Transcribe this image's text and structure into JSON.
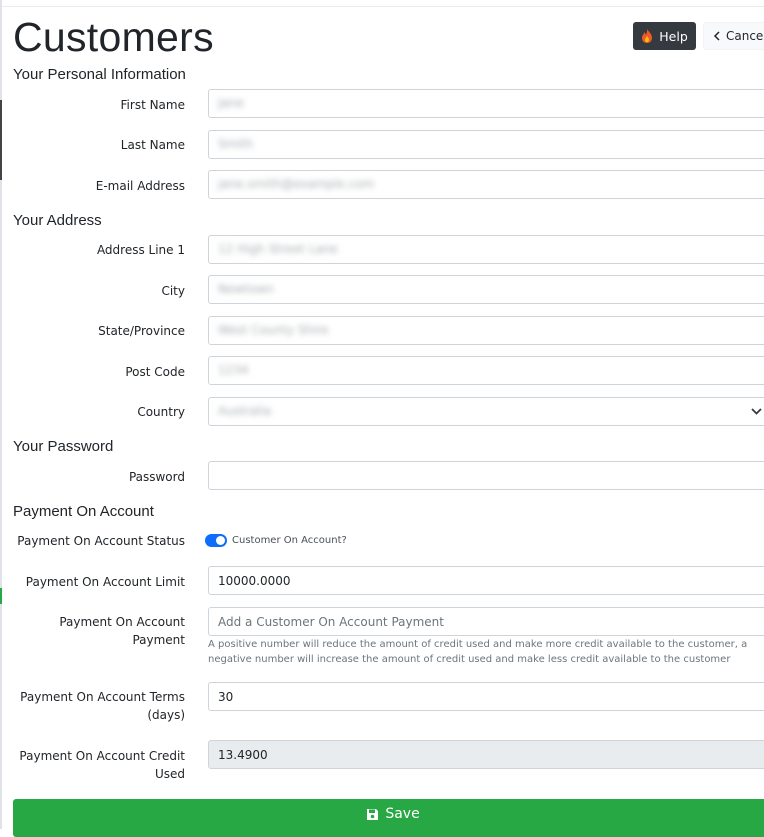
{
  "page": {
    "title": "Customers"
  },
  "header": {
    "help_label": "Help",
    "cancel_label": "Cancel"
  },
  "sections": {
    "personal": "Your Personal Information",
    "address": "Your Address",
    "password": "Your Password",
    "payment": "Payment On Account"
  },
  "personal": {
    "first_name_label": "First Name",
    "first_name_value": "Jane",
    "last_name_label": "Last Name",
    "last_name_value": "Smith",
    "email_label": "E-mail Address",
    "email_value": "jane.smith@example.com"
  },
  "address": {
    "line1_label": "Address Line 1",
    "line1_value": "12 High Street Lane",
    "city_label": "City",
    "city_value": "Newtown",
    "state_label": "State/Province",
    "state_value": "West County Shire",
    "postcode_label": "Post Code",
    "postcode_value": "1234",
    "country_label": "Country",
    "country_value": "Australia"
  },
  "password": {
    "label": "Password",
    "value": ""
  },
  "payment": {
    "status_label": "Payment On Account Status",
    "status_toggle_label": "Customer On Account?",
    "status_on": true,
    "limit_label": "Payment On Account Limit",
    "limit_value": "10000.0000",
    "payment_label": "Payment On Account Payment",
    "payment_placeholder": "Add a Customer On Account Payment",
    "payment_help": "A positive number will reduce the amount of credit used and make more credit available to the customer, a negative number will increase the amount of credit used and make less credit available to the customer",
    "terms_label": "Payment On Account Terms (days)",
    "terms_value": "30",
    "credit_label": "Payment On Account Credit Used",
    "credit_value": "13.4900"
  },
  "footer": {
    "save_label": "Save"
  },
  "colors": {
    "accent": "#0d6efd",
    "save": "#28a745",
    "help_bg": "#343a40",
    "flame": "#f05a28"
  }
}
